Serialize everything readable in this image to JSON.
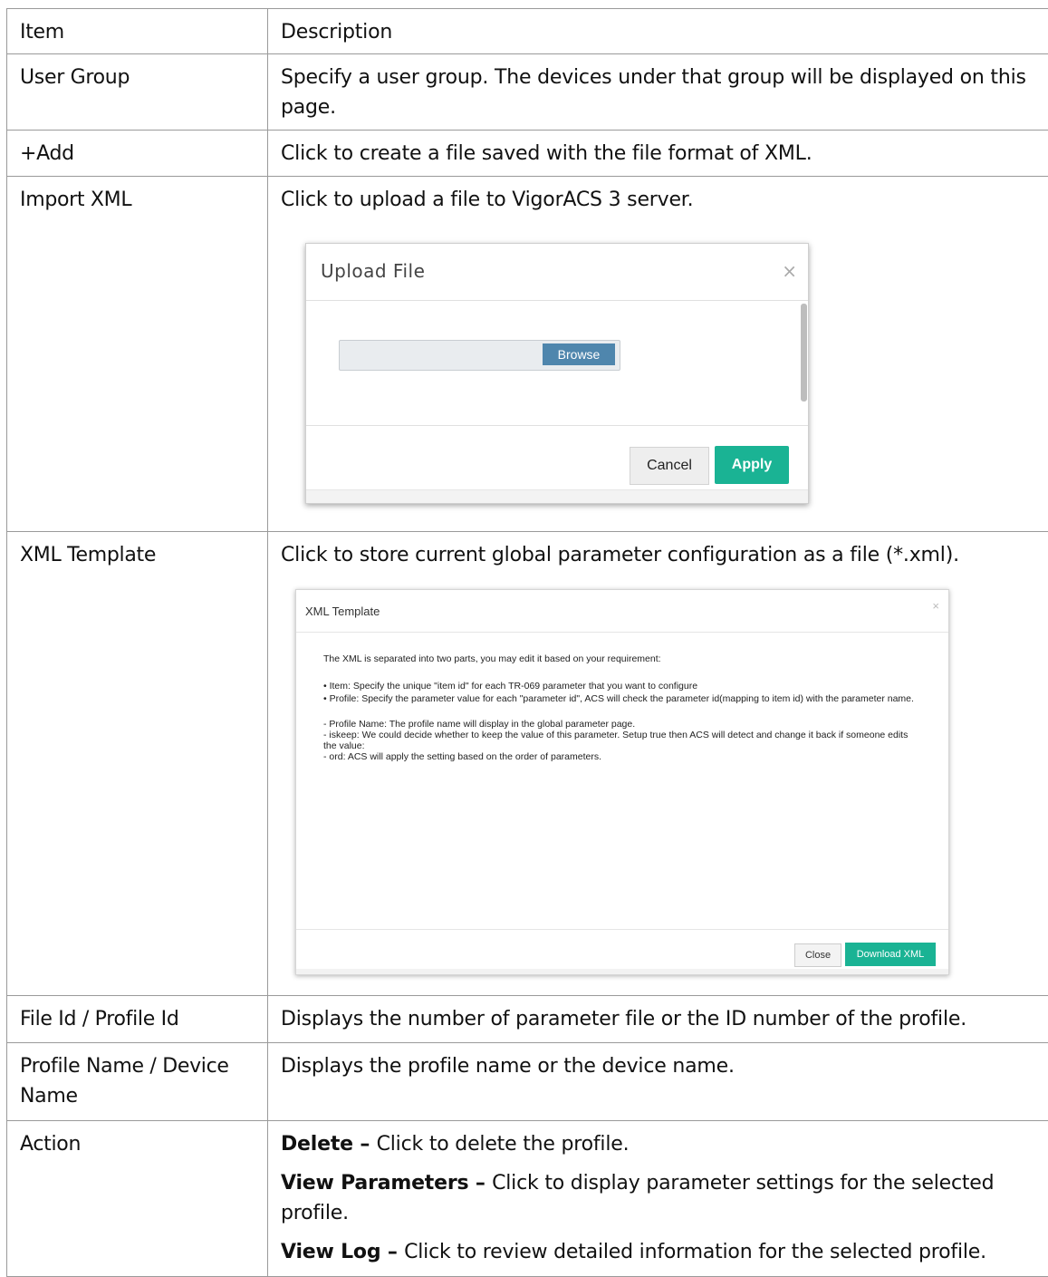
{
  "table": {
    "header": {
      "item": "Item",
      "description": "Description"
    },
    "rows": [
      {
        "item": "User Group",
        "desc": "Specify a user group. The devices under that group will be displayed on this page."
      },
      {
        "item": "+Add",
        "desc": "Click to create a file saved with the file format of XML."
      },
      {
        "item": "Import XML",
        "desc": "Click to upload a file to VigorACS 3 server."
      },
      {
        "item": "XML Template",
        "desc": "Click to store current global parameter configuration as a file (*.xml)."
      },
      {
        "item": "File Id / Profile Id",
        "desc": "Displays the number of parameter file or the ID number of the profile."
      },
      {
        "item": "Profile Name / Device Name",
        "desc": "Displays the profile name or the device name."
      },
      {
        "item": "Action",
        "actions": [
          {
            "term": "Delete",
            "sep": " – ",
            "text": "Click to delete the profile."
          },
          {
            "term": "View Parameters",
            "sep": " – ",
            "text": "Click to display parameter settings for the selected profile."
          },
          {
            "term": "View Log",
            "sep": " – ",
            "text": "Click to review detailed information for the selected profile."
          }
        ]
      }
    ]
  },
  "upload_dialog": {
    "title": "Upload File",
    "close_icon": "×",
    "browse_label": "Browse",
    "cancel_label": "Cancel",
    "apply_label": "Apply"
  },
  "xml_dialog": {
    "title": "XML Template",
    "close_icon": "×",
    "intro": "The XML is separated into two parts, you may edit it based on your requirement:",
    "bullet1": "•   Item: Specify the unique \"item id\" for each TR-069 parameter that you want to configure",
    "bullet2": "•   Profile: Specify the parameter value for each \"parameter id\", ACS will check the parameter id(mapping to item id) with the parameter name.",
    "line1": "- Profile Name: The profile name will display in the global parameter page.",
    "line2": "- iskeep: We could decide whether to keep the value of this parameter. Setup true then ACS will detect and change it back if someone edits the value:",
    "line3": "- ord: ACS will apply the setting based on the order of parameters.",
    "close_label": "Close",
    "download_label": "Download XML"
  },
  "colors": {
    "accent_green": "#1ab394",
    "browse_blue": "#4f86ad",
    "border": "#9a9a9a"
  }
}
